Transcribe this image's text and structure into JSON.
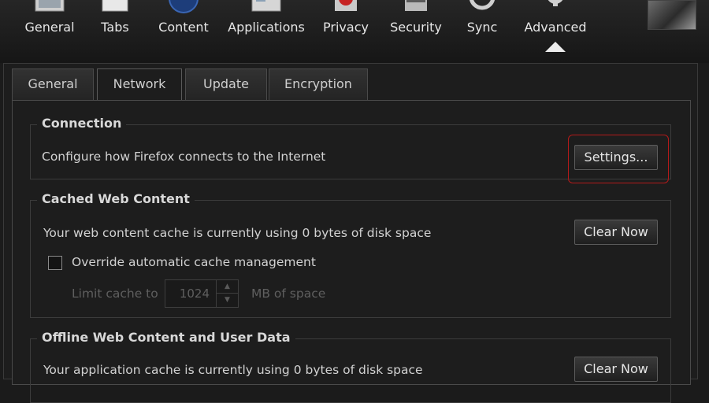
{
  "toolbar": {
    "items": [
      {
        "label": "General",
        "icon": "general-icon"
      },
      {
        "label": "Tabs",
        "icon": "tabs-icon"
      },
      {
        "label": "Content",
        "icon": "content-icon"
      },
      {
        "label": "Applications",
        "icon": "applications-icon"
      },
      {
        "label": "Privacy",
        "icon": "privacy-icon"
      },
      {
        "label": "Security",
        "icon": "security-icon"
      },
      {
        "label": "Sync",
        "icon": "sync-icon"
      },
      {
        "label": "Advanced",
        "icon": "gear-icon",
        "selected": true
      }
    ]
  },
  "tabs": [
    {
      "label": "General"
    },
    {
      "label": "Network",
      "selected": true
    },
    {
      "label": "Update"
    },
    {
      "label": "Encryption"
    }
  ],
  "connection": {
    "title": "Connection",
    "description": "Configure how Firefox connects to the Internet",
    "settings_button": "Settings...",
    "highlight_color": "#b31a1a"
  },
  "cache": {
    "title": "Cached Web Content",
    "status": "Your web content cache is currently using 0 bytes of disk space",
    "clear_button": "Clear Now",
    "override_label": "Override automatic cache management",
    "override_checked": false,
    "limit_label": "Limit cache to",
    "limit_value": "1024",
    "limit_unit": "MB of space"
  },
  "offline": {
    "title": "Offline Web Content and User Data",
    "status": "Your application cache is currently using 0 bytes of disk space",
    "clear_button": "Clear Now"
  }
}
